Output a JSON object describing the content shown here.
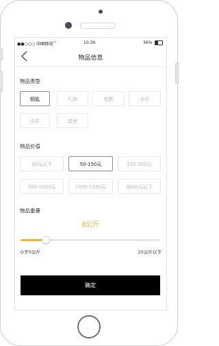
{
  "status_bar": {
    "carrier": "●●○○○ 中国移动",
    "time": "10:30",
    "battery": "36%"
  },
  "nav": {
    "title": "物品信息"
  },
  "item_type": {
    "label": "物品类型",
    "options": [
      "钥匙",
      "礼物",
      "包裹",
      "大件",
      "小件",
      "其他"
    ],
    "selected": "钥匙"
  },
  "item_value": {
    "label": "物品价值",
    "options": [
      "50元以下",
      "50-150元",
      "150-300元",
      "300-1000元",
      "1000-1500元",
      "3000元以下"
    ],
    "selected": "50-150元"
  },
  "item_weight": {
    "label": "物品重量",
    "value": "8公斤",
    "min_label": "小于5公斤",
    "max_label": "25公斤以下",
    "slider_fraction": 0.18
  },
  "confirm_button": {
    "label": "确定"
  },
  "colors": {
    "accent": "#f0b233",
    "button_bg": "#000000"
  }
}
